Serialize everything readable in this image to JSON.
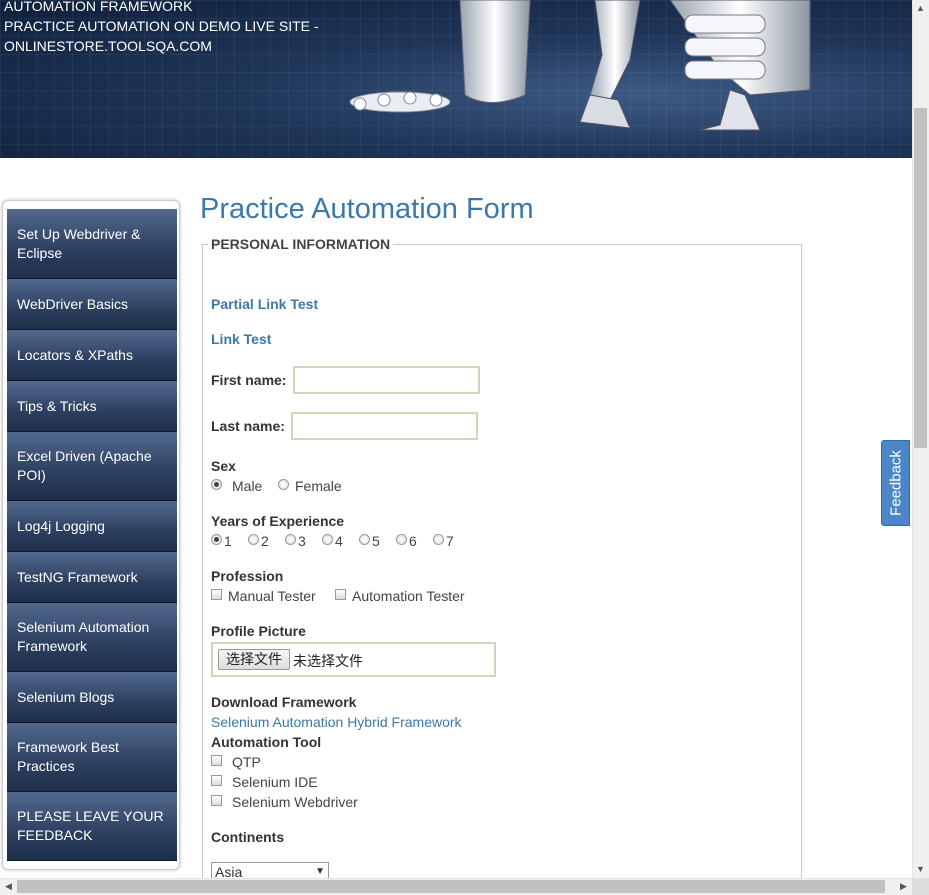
{
  "banner": {
    "line1": "AUTOMATION FRAMEWORK",
    "line2": "PRACTICE AUTOMATION ON DEMO LIVE SITE -",
    "line3": "ONLINESTORE.TOOLSQA.COM"
  },
  "sidebar": {
    "items": [
      {
        "label": "Set Up Webdriver & Eclipse"
      },
      {
        "label": "WebDriver Basics"
      },
      {
        "label": "Locators & XPaths"
      },
      {
        "label": "Tips & Tricks"
      },
      {
        "label": "Excel Driven (Apache POI)"
      },
      {
        "label": "Log4j Logging"
      },
      {
        "label": "TestNG Framework"
      },
      {
        "label": "Selenium Automation Framework"
      },
      {
        "label": "Selenium Blogs"
      },
      {
        "label": "Framework Best Practices"
      },
      {
        "label": "PLEASE LEAVE YOUR FEEDBACK"
      }
    ]
  },
  "form": {
    "title": "Practice Automation Form",
    "legend": "PERSONAL INFORMATION",
    "partial_link": "Partial Link Test",
    "link": "Link Test",
    "first_name_label": "First name:",
    "first_name_value": "",
    "last_name_label": "Last name:",
    "last_name_value": "",
    "sex_label": "Sex",
    "sex_options": [
      "Male",
      "Female"
    ],
    "sex_selected": "Male",
    "experience_label": "Years of Experience",
    "experience_options": [
      "1",
      "2",
      "3",
      "4",
      "5",
      "6",
      "7"
    ],
    "experience_selected": "1",
    "profession_label": "Profession",
    "profession_options": [
      "Manual Tester",
      "Automation Tester"
    ],
    "profile_picture_label": "Profile Picture",
    "file_button": "选择文件",
    "file_status": "未选择文件",
    "download_label": "Download Framework",
    "download_link": "Selenium Automation Hybrid Framework",
    "tool_label": "Automation Tool",
    "tool_options": [
      "QTP",
      "Selenium IDE",
      "Selenium Webdriver"
    ],
    "continents_label": "Continents",
    "continents_value": "Asia"
  },
  "feedback_tab": "Feedback",
  "colors": {
    "link": "#3b79a8",
    "nav_bg": "#2c3f5f",
    "feedback_bg": "#4c86c6"
  }
}
